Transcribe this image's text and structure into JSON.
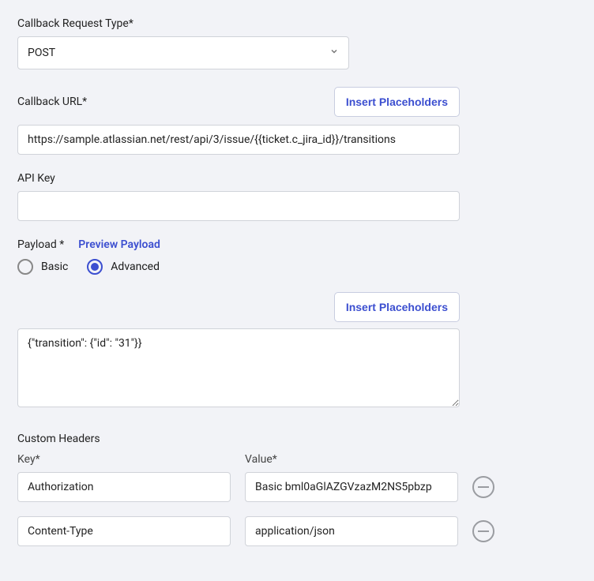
{
  "requestType": {
    "label": "Callback Request Type*",
    "value": "POST"
  },
  "callbackUrl": {
    "label": "Callback URL*",
    "insertBtn": "Insert Placeholders",
    "value": "https://sample.atlassian.net/rest/api/3/issue/{{ticket.c_jira_id}}/transitions"
  },
  "apiKey": {
    "label": "API Key",
    "value": ""
  },
  "payload": {
    "label": "Payload *",
    "previewLink": "Preview Payload",
    "basicLabel": "Basic",
    "advancedLabel": "Advanced",
    "insertBtn": "Insert Placeholders",
    "body": "{\"transition\": {\"id\": \"31\"}}"
  },
  "customHeaders": {
    "label": "Custom Headers",
    "keyLabel": "Key*",
    "valueLabel": "Value*",
    "rows": [
      {
        "key": "Authorization",
        "value": "Basic bml0aGlAZGVzazM2NS5pbzp"
      },
      {
        "key": "Content-Type",
        "value": "application/json"
      }
    ]
  }
}
